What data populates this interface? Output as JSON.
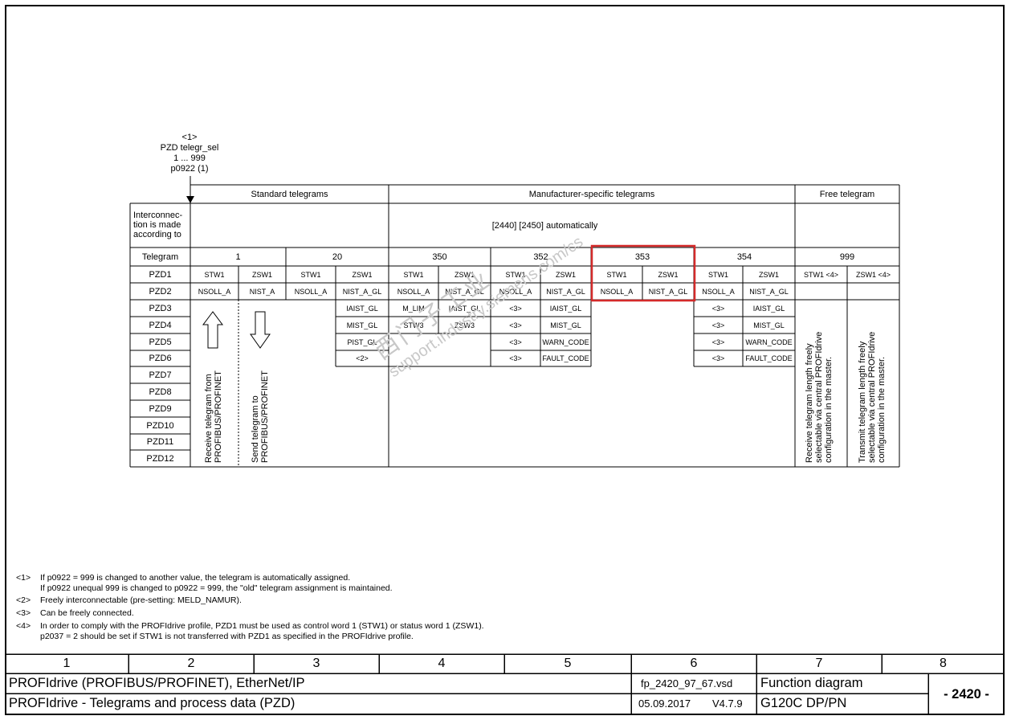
{
  "header": {
    "note_ref": "<1>",
    "param_name": "PZD telegr_sel",
    "param_range": "1 ... 999",
    "param_id": "p0922 (1)"
  },
  "groups": {
    "standard": "Standard telegrams",
    "manufacturer": "Manufacturer-specific telegrams",
    "free": "Free telegram"
  },
  "interconnection": {
    "label_1": "Interconnec-",
    "label_2": "tion is made",
    "label_3": "according to",
    "value": "[2440] [2450] automatically"
  },
  "telegram_row": {
    "label": "Telegram",
    "t1": "1",
    "t20": "20",
    "t350": "350",
    "t352": "352",
    "t353": "353",
    "t354": "354",
    "t999": "999"
  },
  "pzd_labels": [
    "PZD1",
    "PZD2",
    "PZD3",
    "PZD4",
    "PZD5",
    "PZD6",
    "PZD7",
    "PZD8",
    "PZD9",
    "PZD10",
    "PZD11",
    "PZD12"
  ],
  "cells": {
    "t1": {
      "r1": [
        "STW1",
        "ZSW1"
      ],
      "r2": [
        "NSOLL_A",
        "NIST_A"
      ]
    },
    "t20": {
      "r1": [
        "STW1",
        "ZSW1"
      ],
      "r2": [
        "NSOLL_A",
        "NIST_A_GL"
      ],
      "zsw_extra": [
        "IAIST_GL",
        "MIST_GL",
        "PIST_GL",
        "<2>"
      ]
    },
    "t350": {
      "r1": [
        "STW1",
        "ZSW1"
      ],
      "r2": [
        "NSOLL_A",
        "NIST_A_GL"
      ],
      "r3": [
        "M_LIM",
        "IAIST_GL"
      ],
      "r4": [
        "STW3",
        "ZSW3"
      ]
    },
    "t352": {
      "r1": [
        "STW1",
        "ZSW1"
      ],
      "r2": [
        "NSOLL_A",
        "NIST_A_GL"
      ],
      "left_extra": [
        "<3>",
        "<3>",
        "<3>",
        "<3>"
      ],
      "right_extra": [
        "IAIST_GL",
        "MIST_GL",
        "WARN_CODE",
        "FAULT_CODE"
      ]
    },
    "t353": {
      "r1": [
        "STW1",
        "ZSW1"
      ],
      "r2": [
        "NSOLL_A",
        "NIST_A_GL"
      ]
    },
    "t354": {
      "r1": [
        "STW1",
        "ZSW1"
      ],
      "r2": [
        "NSOLL_A",
        "NIST_A_GL"
      ],
      "left_extra": [
        "<3>",
        "<3>",
        "<3>",
        "<3>"
      ],
      "right_extra": [
        "IAIST_GL",
        "MIST_GL",
        "WARN_CODE",
        "FAULT_CODE"
      ]
    },
    "t999": {
      "r1": [
        "STW1 <4>",
        "ZSW1 <4>"
      ]
    }
  },
  "arrows": {
    "receive_1": "Receive telegram from",
    "receive_2": "PROFIBUS/PROFINET",
    "send_1": "Send telegram to",
    "send_2": "PROFIBUS/PROFINET"
  },
  "free_notes": {
    "receive": [
      "Receive telegram length freely",
      "selectable via central PROFIdrive",
      "configuration in the master."
    ],
    "transmit": [
      "Transmit telegram length freely",
      "selectable via central PROFIdrive",
      "configuration in the master."
    ]
  },
  "watermark": {
    "line1": "西门子工业",
    "line2": "support.industry.siemens.com/cs"
  },
  "footnotes": [
    {
      "ref": "<1>",
      "lines": [
        "If p0922 = 999 is changed to another value, the telegram is automatically assigned.",
        "If p0922 unequal 999 is changed to p0922 = 999, the \"old\" telegram assignment is maintained."
      ]
    },
    {
      "ref": "<2>",
      "lines": [
        "Freely interconnectable (pre-setting: MELD_NAMUR)."
      ]
    },
    {
      "ref": "<3>",
      "lines": [
        "Can be freely connected."
      ]
    },
    {
      "ref": "<4>",
      "lines": [
        "In order to comply with the PROFIdrive profile, PZD1 must be used as control word 1 (STW1) or status word 1 (ZSW1).",
        "p2037 = 2 should be set if STW1 is not transferred with PZD1 as specified in the PROFIdrive profile."
      ]
    }
  ],
  "footer": {
    "columns": [
      "1",
      "2",
      "3",
      "4",
      "5",
      "6",
      "7",
      "8"
    ],
    "title_1": "PROFIdrive (PROFIBUS/PROFINET), EtherNet/IP",
    "title_2": "PROFIdrive - Telegrams and process data (PZD)",
    "file": "fp_2420_97_67.vsd",
    "date": "05.09.2017",
    "version": "V4.7.9",
    "kind": "Function diagram",
    "device": "G120C DP/PN",
    "number": "- 2420 -"
  },
  "colors": {
    "highlight": "#d42a2a",
    "watermark": "#c8c8c8"
  }
}
